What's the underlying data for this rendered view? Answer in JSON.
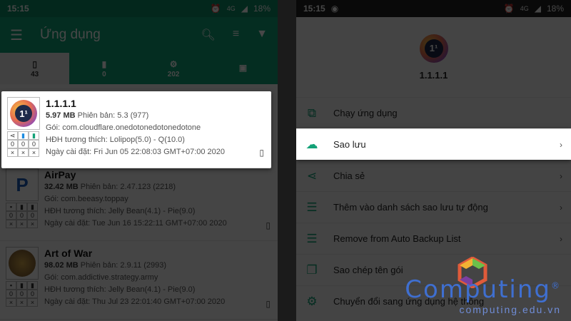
{
  "left": {
    "status": {
      "time": "15:15",
      "signal": "4G",
      "battery": "18%"
    },
    "appbar": {
      "title": "Ứng dụng"
    },
    "tabs": [
      {
        "icon": "phone-icon",
        "count": "43"
      },
      {
        "icon": "sdcard-icon",
        "count": "0"
      },
      {
        "icon": "gear-icon",
        "count": "202"
      },
      {
        "icon": "archive-icon",
        "count": ""
      }
    ],
    "apps": [
      {
        "name": "1.1.1.1",
        "size": "5.97 MB",
        "version": "Phiên bản: 5.3 (977)",
        "package": "Gói: com.cloudflare.onedotonedotonedotone",
        "compat": "HĐH tương thích: Lolipop(5.0) - Q(10.0)",
        "installed": "Ngày cài đặt: Fri Jun 05 22:08:03 GMT+07:00 2020"
      },
      {
        "name": "AirPay",
        "size": "32.42 MB",
        "version": "Phiên bản: 2.47.123 (2218)",
        "package": "Gói: com.beeasy.toppay",
        "compat": "HĐH tương thích: Jelly Bean(4.1) - Pie(9.0)",
        "installed": "Ngày cài đặt: Tue Jun 16 15:22:11 GMT+07:00 2020"
      },
      {
        "name": "Art of War",
        "size": "98.02 MB",
        "version": "Phiên bản: 2.9.11 (2993)",
        "package": "Gói: com.addictive.strategy.army",
        "compat": "HĐH tương thích: Jelly Bean(4.1) - Pie(9.0)",
        "installed": "Ngày cài đặt: Thu Jul 23 22:01:40 GMT+07:00 2020"
      }
    ]
  },
  "right": {
    "status": {
      "time": "15:15",
      "signal": "4G",
      "battery": "18%"
    },
    "app_name": "1.1.1.1",
    "menu": [
      {
        "icon": "launch-icon",
        "label": "Chạy ứng dụng",
        "chevron": ""
      },
      {
        "icon": "cloud-upload-icon",
        "label": "Sao lưu",
        "chevron": "›"
      },
      {
        "icon": "share-icon",
        "label": "Chia sẻ",
        "chevron": "›"
      },
      {
        "icon": "playlist-add-icon",
        "label": "Thêm vào danh sách sao lưu tự động",
        "chevron": "›"
      },
      {
        "icon": "playlist-remove-icon",
        "label": "Remove from Auto Backup List",
        "chevron": "›"
      },
      {
        "icon": "copy-icon",
        "label": "Sao chép tên gói",
        "chevron": ""
      },
      {
        "icon": "gear-icon",
        "label": "Chuyển đổi sang ứng dụng hệ thống",
        "chevron": ""
      }
    ]
  },
  "watermark": {
    "title": "Computing",
    "url": "computing.edu.vn",
    "reg": "®"
  },
  "colors": {
    "accent": "#11a077",
    "watermark": "#3f6fd0"
  }
}
